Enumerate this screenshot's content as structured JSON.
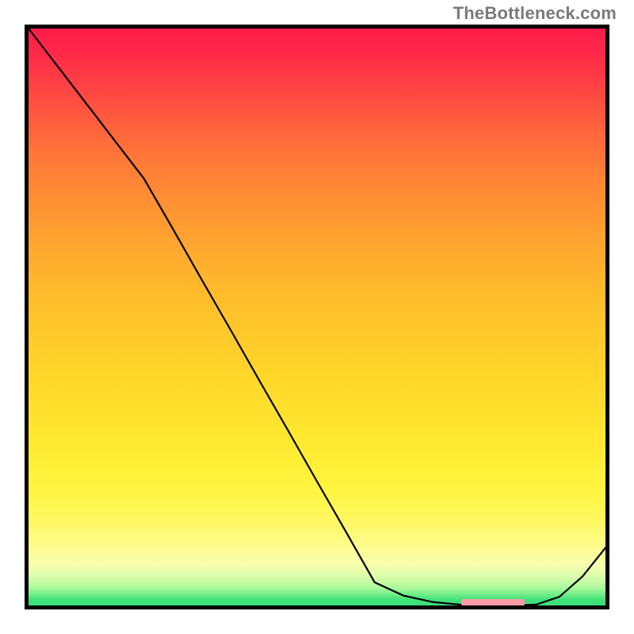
{
  "watermark": "TheBottleneck.com",
  "chart_data": {
    "type": "line",
    "title": "",
    "xlabel": "",
    "ylabel": "",
    "x": [
      0,
      5,
      10,
      15,
      20,
      25,
      30,
      35,
      40,
      45,
      50,
      55,
      60,
      65,
      70,
      75,
      78,
      81,
      84,
      88,
      92,
      96,
      100
    ],
    "values": [
      100,
      93.5,
      87.0,
      80.5,
      74.0,
      65.3,
      56.5,
      47.8,
      39.0,
      30.3,
      21.5,
      12.8,
      4.0,
      1.7,
      0.6,
      0.12,
      0.0,
      0.0,
      0.0,
      0.15,
      1.5,
      5.0,
      10.0
    ],
    "xlim": [
      0,
      100
    ],
    "ylim": [
      0,
      100
    ],
    "optimal_band": {
      "x_start": 75,
      "x_end": 86
    },
    "background_gradient": {
      "top_color": "#ff1c4b",
      "mid_color": "#ffd62a",
      "bottom_color": "#3ae078"
    }
  }
}
